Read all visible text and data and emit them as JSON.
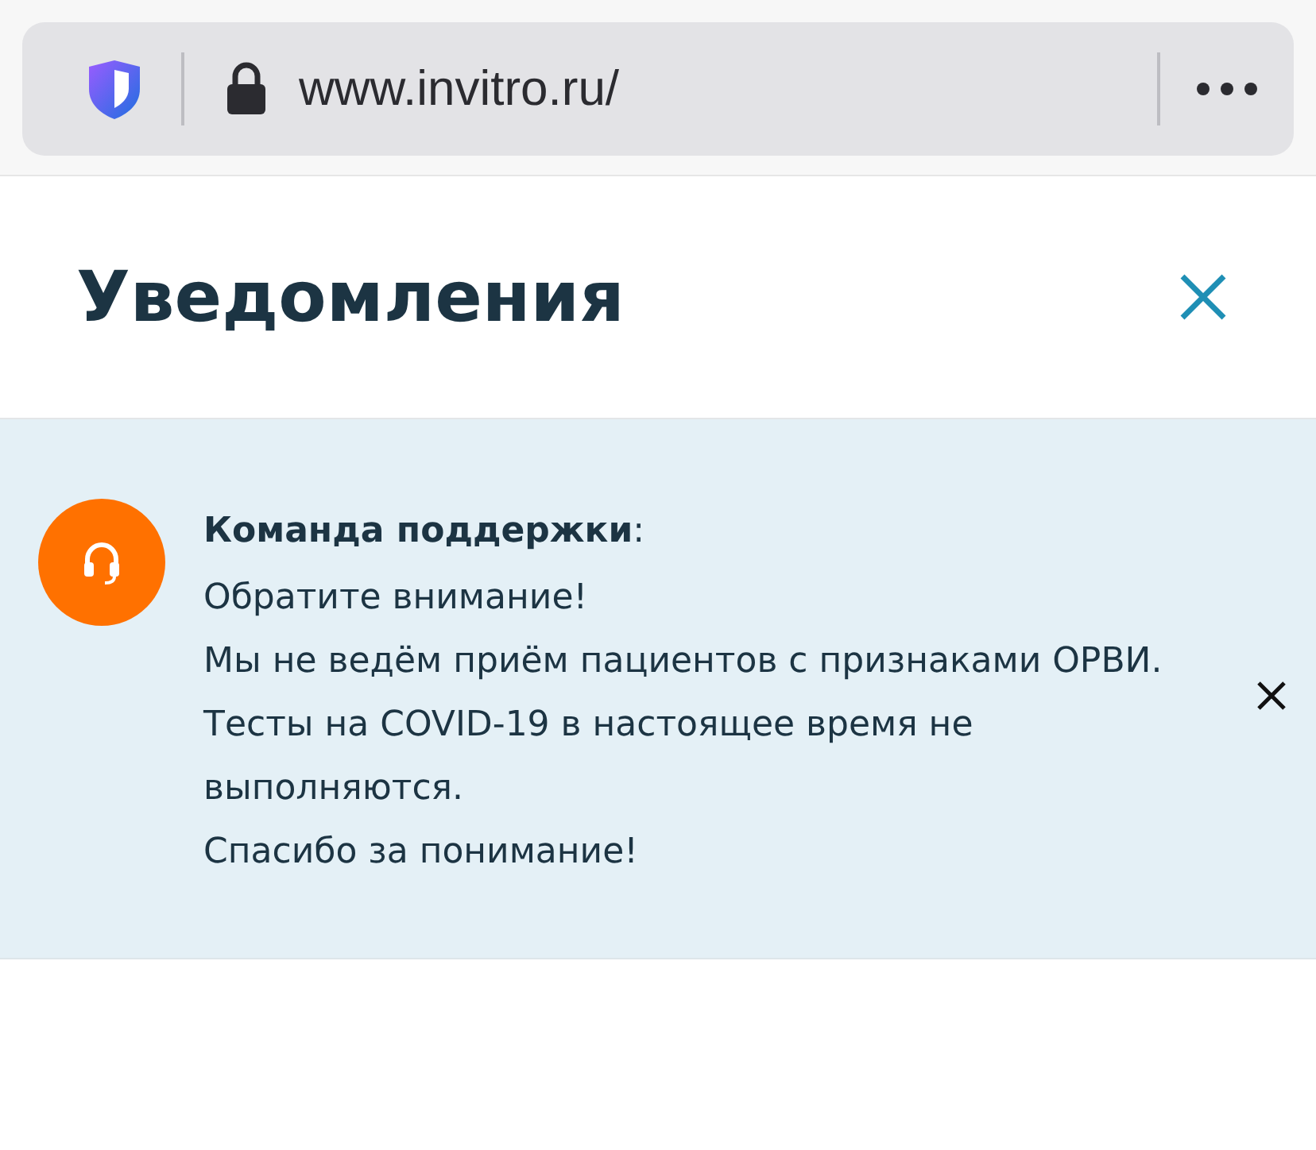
{
  "browser": {
    "url": "www.invitro.ru/"
  },
  "header": {
    "title": "Уведомления"
  },
  "notifications": [
    {
      "sender": "**Команда поддержки**:",
      "lines": [
        "Обратите внимание!",
        "Мы не ведём приём пациентов с признаками ОРВИ.",
        "Тесты на COVID-19 в настоящее время не выполняются.",
        "Спасибо за понимание!"
      ]
    }
  ]
}
